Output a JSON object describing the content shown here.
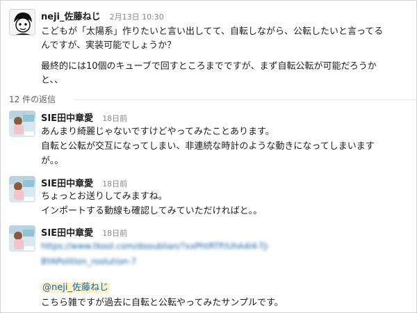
{
  "thread_root": {
    "author": "neji_佐藤ねじ",
    "timestamp": "2月13日 10:30",
    "lines": [
      "こどもが「太陽系」作りたいと言い出してて、自転しながら、公転したいと言ってる",
      "んですが、実装可能でしょうか？",
      "最終的には10個のキューブで回すところまでですが、まず自転公転が可能だろうか",
      "と、、"
    ]
  },
  "replies_count": "12 件の返信",
  "replies": [
    {
      "author": "SIE田中章愛",
      "timestamp": "18日前",
      "lines": [
        "あんまり綺麗じゃないですけどやってみたことあります。",
        "自転と公転が交互になってしまい、非連続な時計のような動きになってしまいます",
        "が。。"
      ]
    },
    {
      "author": "SIE田中章愛",
      "timestamp": "18日前",
      "lines": [
        "ちょっとお送りしてみますね。",
        "インポートする動線も確認してみていただければと。。"
      ]
    },
    {
      "author": "SIE田中章愛",
      "timestamp": "18日前",
      "blurred_link": [
        "https://www.tkool.com/dooublian/?xxPhtRTP/UhA4I4-TJ-",
        "BYAPolitlon_roolution-7"
      ],
      "mention": "@neji_佐藤ねじ",
      "lines": [
        "こちら雑ですが過去に自転と公転やってみたサンプルです。"
      ]
    }
  ],
  "colors": {
    "link": "#1264a3",
    "mention_bg": "#fdf1c9",
    "muted": "#868686"
  }
}
